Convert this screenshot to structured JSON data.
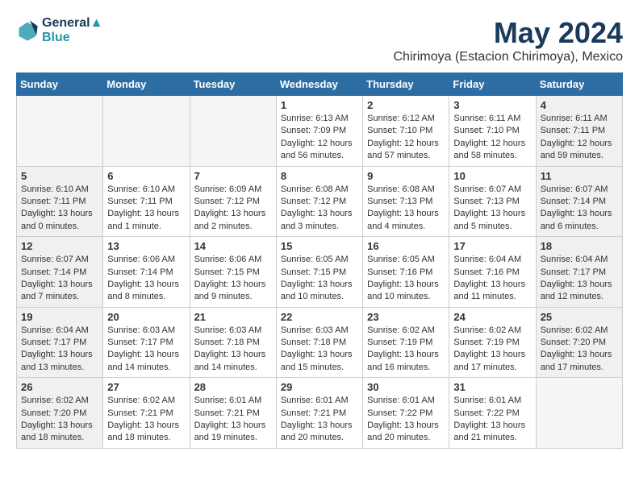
{
  "header": {
    "logo_line1": "General",
    "logo_line2": "Blue",
    "month": "May 2024",
    "location": "Chirimoya (Estacion Chirimoya), Mexico"
  },
  "days_of_week": [
    "Sunday",
    "Monday",
    "Tuesday",
    "Wednesday",
    "Thursday",
    "Friday",
    "Saturday"
  ],
  "weeks": [
    [
      {
        "day": "",
        "text": "",
        "empty": true
      },
      {
        "day": "",
        "text": "",
        "empty": true
      },
      {
        "day": "",
        "text": "",
        "empty": true
      },
      {
        "day": "1",
        "text": "Sunrise: 6:13 AM\nSunset: 7:09 PM\nDaylight: 12 hours and 56 minutes."
      },
      {
        "day": "2",
        "text": "Sunrise: 6:12 AM\nSunset: 7:10 PM\nDaylight: 12 hours and 57 minutes."
      },
      {
        "day": "3",
        "text": "Sunrise: 6:11 AM\nSunset: 7:10 PM\nDaylight: 12 hours and 58 minutes."
      },
      {
        "day": "4",
        "text": "Sunrise: 6:11 AM\nSunset: 7:11 PM\nDaylight: 12 hours and 59 minutes."
      }
    ],
    [
      {
        "day": "5",
        "text": "Sunrise: 6:10 AM\nSunset: 7:11 PM\nDaylight: 13 hours and 0 minutes."
      },
      {
        "day": "6",
        "text": "Sunrise: 6:10 AM\nSunset: 7:11 PM\nDaylight: 13 hours and 1 minute."
      },
      {
        "day": "7",
        "text": "Sunrise: 6:09 AM\nSunset: 7:12 PM\nDaylight: 13 hours and 2 minutes."
      },
      {
        "day": "8",
        "text": "Sunrise: 6:08 AM\nSunset: 7:12 PM\nDaylight: 13 hours and 3 minutes."
      },
      {
        "day": "9",
        "text": "Sunrise: 6:08 AM\nSunset: 7:13 PM\nDaylight: 13 hours and 4 minutes."
      },
      {
        "day": "10",
        "text": "Sunrise: 6:07 AM\nSunset: 7:13 PM\nDaylight: 13 hours and 5 minutes."
      },
      {
        "day": "11",
        "text": "Sunrise: 6:07 AM\nSunset: 7:14 PM\nDaylight: 13 hours and 6 minutes."
      }
    ],
    [
      {
        "day": "12",
        "text": "Sunrise: 6:07 AM\nSunset: 7:14 PM\nDaylight: 13 hours and 7 minutes."
      },
      {
        "day": "13",
        "text": "Sunrise: 6:06 AM\nSunset: 7:14 PM\nDaylight: 13 hours and 8 minutes."
      },
      {
        "day": "14",
        "text": "Sunrise: 6:06 AM\nSunset: 7:15 PM\nDaylight: 13 hours and 9 minutes."
      },
      {
        "day": "15",
        "text": "Sunrise: 6:05 AM\nSunset: 7:15 PM\nDaylight: 13 hours and 10 minutes."
      },
      {
        "day": "16",
        "text": "Sunrise: 6:05 AM\nSunset: 7:16 PM\nDaylight: 13 hours and 10 minutes."
      },
      {
        "day": "17",
        "text": "Sunrise: 6:04 AM\nSunset: 7:16 PM\nDaylight: 13 hours and 11 minutes."
      },
      {
        "day": "18",
        "text": "Sunrise: 6:04 AM\nSunset: 7:17 PM\nDaylight: 13 hours and 12 minutes."
      }
    ],
    [
      {
        "day": "19",
        "text": "Sunrise: 6:04 AM\nSunset: 7:17 PM\nDaylight: 13 hours and 13 minutes."
      },
      {
        "day": "20",
        "text": "Sunrise: 6:03 AM\nSunset: 7:17 PM\nDaylight: 13 hours and 14 minutes."
      },
      {
        "day": "21",
        "text": "Sunrise: 6:03 AM\nSunset: 7:18 PM\nDaylight: 13 hours and 14 minutes."
      },
      {
        "day": "22",
        "text": "Sunrise: 6:03 AM\nSunset: 7:18 PM\nDaylight: 13 hours and 15 minutes."
      },
      {
        "day": "23",
        "text": "Sunrise: 6:02 AM\nSunset: 7:19 PM\nDaylight: 13 hours and 16 minutes."
      },
      {
        "day": "24",
        "text": "Sunrise: 6:02 AM\nSunset: 7:19 PM\nDaylight: 13 hours and 17 minutes."
      },
      {
        "day": "25",
        "text": "Sunrise: 6:02 AM\nSunset: 7:20 PM\nDaylight: 13 hours and 17 minutes."
      }
    ],
    [
      {
        "day": "26",
        "text": "Sunrise: 6:02 AM\nSunset: 7:20 PM\nDaylight: 13 hours and 18 minutes."
      },
      {
        "day": "27",
        "text": "Sunrise: 6:02 AM\nSunset: 7:21 PM\nDaylight: 13 hours and 18 minutes."
      },
      {
        "day": "28",
        "text": "Sunrise: 6:01 AM\nSunset: 7:21 PM\nDaylight: 13 hours and 19 minutes."
      },
      {
        "day": "29",
        "text": "Sunrise: 6:01 AM\nSunset: 7:21 PM\nDaylight: 13 hours and 20 minutes."
      },
      {
        "day": "30",
        "text": "Sunrise: 6:01 AM\nSunset: 7:22 PM\nDaylight: 13 hours and 20 minutes."
      },
      {
        "day": "31",
        "text": "Sunrise: 6:01 AM\nSunset: 7:22 PM\nDaylight: 13 hours and 21 minutes."
      },
      {
        "day": "",
        "text": "",
        "empty": true
      }
    ]
  ]
}
